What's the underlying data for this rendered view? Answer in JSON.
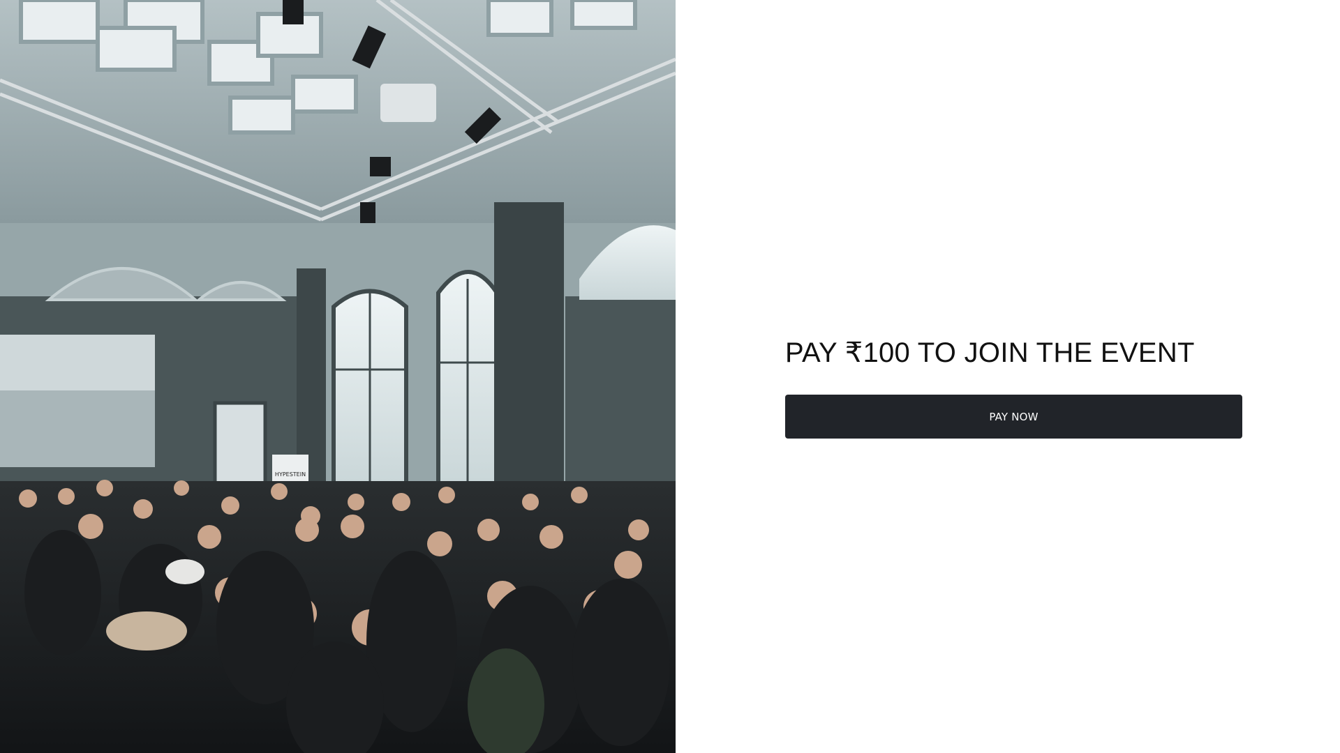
{
  "event": {
    "heading": "PAY ₹100 TO JOIN THE EVENT",
    "pay_button_label": "PAY NOW"
  },
  "photo": {
    "description_icon": "event-crowd-photo",
    "banner_text": "HYPESTEIN"
  },
  "colors": {
    "button_background": "#212429",
    "button_text": "#ffffff",
    "heading_text": "#111111",
    "page_background": "#ffffff"
  }
}
